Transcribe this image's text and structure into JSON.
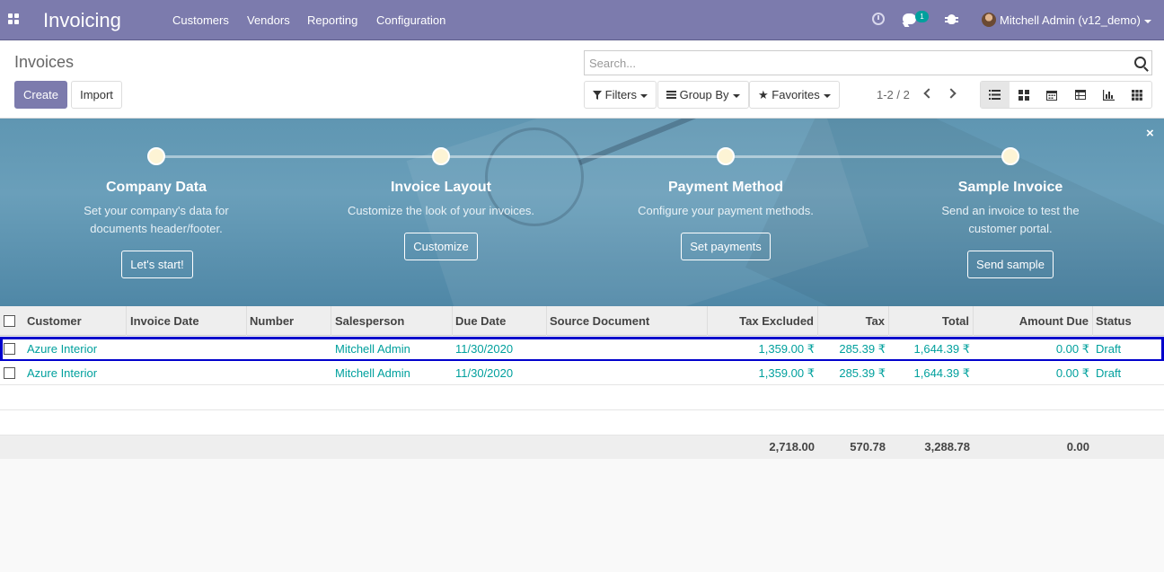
{
  "navbar": {
    "app_title": "Invoicing",
    "menu": [
      "Customers",
      "Vendors",
      "Reporting",
      "Configuration"
    ],
    "chat_badge": "1",
    "user_name": "Mitchell Admin (v12_demo)"
  },
  "control_panel": {
    "breadcrumb": "Invoices",
    "create_label": "Create",
    "import_label": "Import",
    "search_placeholder": "Search...",
    "filters_label": "Filters",
    "group_by_label": "Group By",
    "favorites_label": "Favorites",
    "pager_value": "1-2 / 2",
    "views": [
      "list-view-icon",
      "kanban-view-icon",
      "calendar-view-icon",
      "pivot-view-icon",
      "graph-view-icon",
      "grid-view-icon"
    ],
    "active_view": "list"
  },
  "onboarding": {
    "steps": [
      {
        "title": "Company Data",
        "desc_lines": [
          "Set your company's data for",
          "documents header/footer."
        ],
        "button": "Let's start!"
      },
      {
        "title": "Invoice Layout",
        "desc_lines": [
          "Customize the look of your invoices."
        ],
        "button": "Customize"
      },
      {
        "title": "Payment Method",
        "desc_lines": [
          "Configure your payment methods."
        ],
        "button": "Set payments"
      },
      {
        "title": "Sample Invoice",
        "desc_lines": [
          "Send an invoice to test the",
          "customer portal."
        ],
        "button": "Send sample"
      }
    ],
    "close_symbol": "×"
  },
  "table": {
    "columns": [
      "Customer",
      "Invoice Date",
      "Number",
      "Salesperson",
      "Due Date",
      "Source Document",
      "Tax Excluded",
      "Tax",
      "Total",
      "Amount Due",
      "Status"
    ],
    "rows": [
      {
        "customer": "Azure Interior",
        "invoice_date": "",
        "number": "",
        "salesperson": "Mitchell Admin",
        "due_date": "11/30/2020",
        "source": "",
        "tax_excluded": "1,359.00 ₹",
        "tax": "285.39 ₹",
        "total": "1,644.39 ₹",
        "amount_due": "0.00 ₹",
        "status": "Draft"
      },
      {
        "customer": "Azure Interior",
        "invoice_date": "",
        "number": "",
        "salesperson": "Mitchell Admin",
        "due_date": "11/30/2020",
        "source": "",
        "tax_excluded": "1,359.00 ₹",
        "tax": "285.39 ₹",
        "total": "1,644.39 ₹",
        "amount_due": "0.00 ₹",
        "status": "Draft"
      }
    ],
    "totals": {
      "tax_excluded": "2,718.00",
      "tax": "570.78",
      "total": "3,288.78",
      "amount_due": "0.00"
    }
  },
  "colors": {
    "brand": "#7c7bad",
    "link": "#00a09d",
    "banner": "#5f96b2",
    "selection": "#0000cc"
  }
}
